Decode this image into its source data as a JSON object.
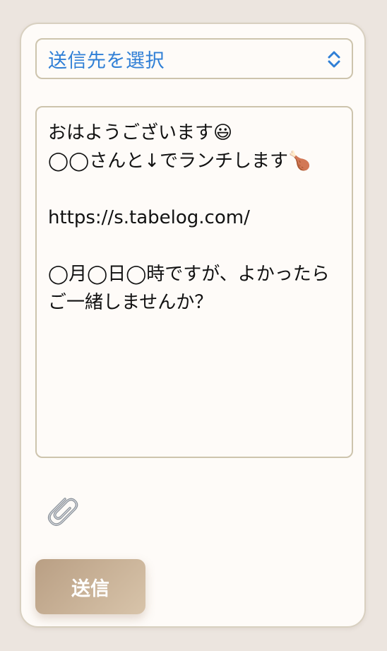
{
  "form": {
    "recipient_select": {
      "selected_label": "送信先を選択"
    },
    "message_text": "おはようございます😃\n◯◯さんと↓でランチします🍗\n\nhttps://s.tabelog.com/\n\n◯月◯日◯時ですが、よかったらご一緒しませんか？",
    "attach_icon": "paperclip-icon",
    "send_label": "送信"
  },
  "colors": {
    "page_background": "#ece5df",
    "card_background": "#fefbf8",
    "border": "#cdc4ad",
    "accent_blue": "#2f7fd6",
    "send_button_start": "#b99f84",
    "send_button_end": "#d8c4aa"
  }
}
